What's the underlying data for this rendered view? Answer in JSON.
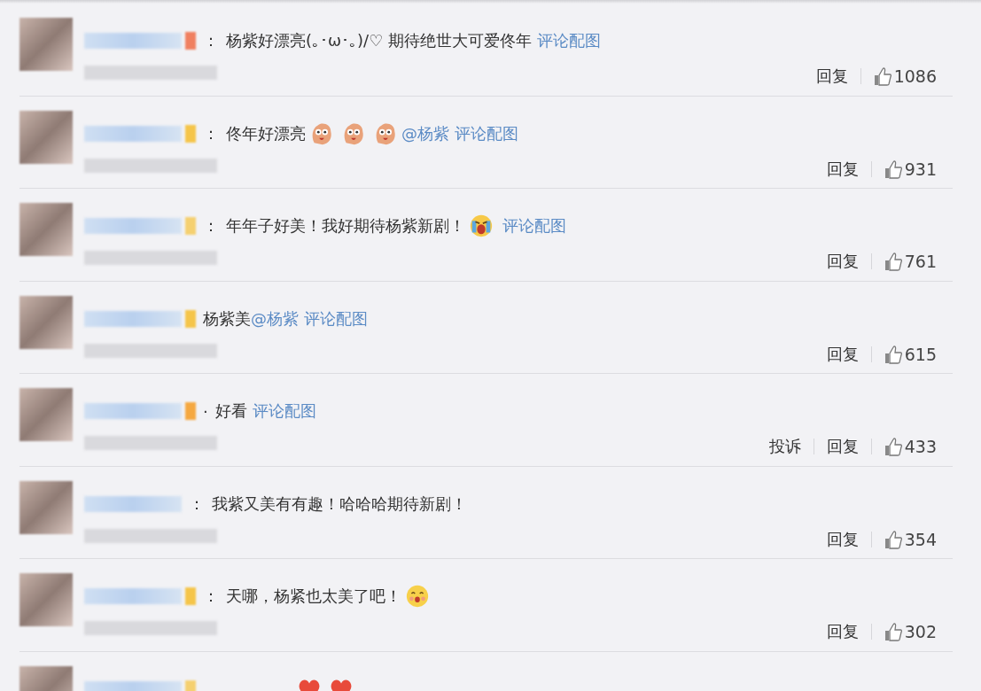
{
  "comments": [
    {
      "badge": {
        "color": "#f08060"
      },
      "prefix": "：",
      "segments": [
        {
          "kind": "text",
          "text": "杨紫好漂亮(｡･ω･｡)/♡ 期待绝世大可爱佟年"
        },
        {
          "kind": "link",
          "text": "评论配图"
        }
      ],
      "actions": [
        "回复"
      ],
      "likes": "1086"
    },
    {
      "badge": {
        "color": "#f5c54a"
      },
      "prefix": "：",
      "segments": [
        {
          "kind": "text",
          "text": "佟年好漂亮"
        },
        {
          "kind": "sticker"
        },
        {
          "kind": "sticker"
        },
        {
          "kind": "sticker"
        },
        {
          "kind": "mention",
          "text": "@杨紫"
        },
        {
          "kind": "link",
          "text": "评论配图"
        }
      ],
      "actions": [
        "回复"
      ],
      "likes": "931"
    },
    {
      "badge": {
        "color": "#f5d070"
      },
      "prefix": "：",
      "segments": [
        {
          "kind": "text",
          "text": "年年子好美！我好期待杨紫新剧！"
        },
        {
          "kind": "emoji-cry"
        },
        {
          "kind": "link",
          "text": "评论配图"
        }
      ],
      "actions": [
        "回复"
      ],
      "likes": "761"
    },
    {
      "badge": {
        "color": "#f5c54a"
      },
      "segments": [
        {
          "kind": "text",
          "text": "杨紫美"
        },
        {
          "kind": "mention",
          "text": "@杨紫"
        },
        {
          "kind": "link",
          "text": "评论配图"
        }
      ],
      "actions": [
        "回复"
      ],
      "likes": "615"
    },
    {
      "badge": {
        "color": "#f5a840"
      },
      "prefix": "·",
      "segments": [
        {
          "kind": "text",
          "text": "好看"
        },
        {
          "kind": "link",
          "text": "评论配图"
        }
      ],
      "actions": [
        "投诉",
        "回复"
      ],
      "likes": "433"
    },
    {
      "prefix": "：",
      "segments": [
        {
          "kind": "text",
          "text": "我紫又美有有趣！哈哈哈期待新剧！"
        }
      ],
      "actions": [
        "回复"
      ],
      "likes": "354"
    },
    {
      "badge": {
        "color": "#f5c54a"
      },
      "prefix": "：",
      "segments": [
        {
          "kind": "text",
          "text": "天哪，杨紧也太美了吧！"
        },
        {
          "kind": "emoji-smile"
        }
      ],
      "actions": [
        "回复"
      ],
      "likes": "302"
    },
    {
      "badge": {
        "color": "#f5d070"
      },
      "segments": [
        {
          "kind": "heart"
        },
        {
          "kind": "heart"
        }
      ]
    }
  ]
}
